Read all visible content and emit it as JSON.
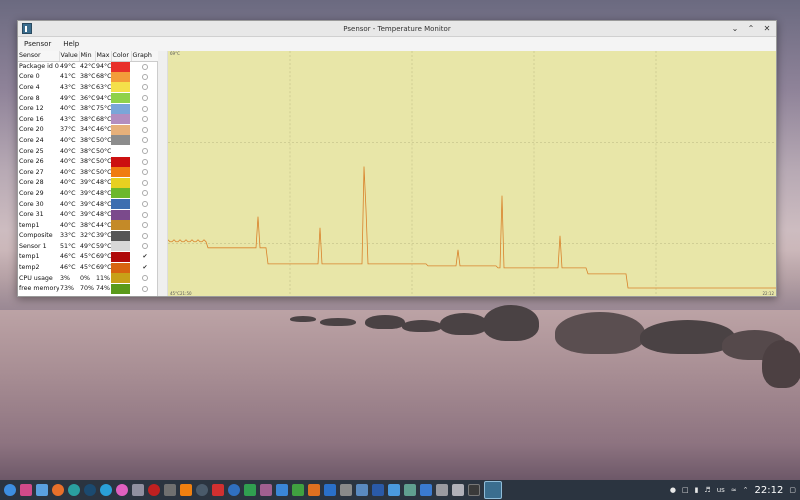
{
  "window": {
    "title": "Psensor - Temperature Monitor"
  },
  "menu": {
    "items": [
      "Psensor",
      "Help"
    ]
  },
  "table": {
    "headers": {
      "sensor": "Sensor",
      "value": "Value",
      "min": "Min",
      "max": "Max",
      "color": "Color",
      "graph": "Graph"
    },
    "rows": [
      {
        "sensor": "Package id 0",
        "value": "49°C",
        "min": "42°C",
        "max": "94°C",
        "color": "#e8302a",
        "graph": false
      },
      {
        "sensor": "Core 0",
        "value": "41°C",
        "min": "38°C",
        "max": "68°C",
        "color": "#f39c3a",
        "graph": false
      },
      {
        "sensor": "Core 4",
        "value": "43°C",
        "min": "38°C",
        "max": "63°C",
        "color": "#f4e04a",
        "graph": false
      },
      {
        "sensor": "Core 8",
        "value": "49°C",
        "min": "36°C",
        "max": "94°C",
        "color": "#8fd24a",
        "graph": false
      },
      {
        "sensor": "Core 12",
        "value": "40°C",
        "min": "38°C",
        "max": "75°C",
        "color": "#7aa6d8",
        "graph": false
      },
      {
        "sensor": "Core 16",
        "value": "43°C",
        "min": "38°C",
        "max": "68°C",
        "color": "#b38ec0",
        "graph": false
      },
      {
        "sensor": "Core 20",
        "value": "37°C",
        "min": "34°C",
        "max": "46°C",
        "color": "#e6b07a",
        "graph": false
      },
      {
        "sensor": "Core 24",
        "value": "40°C",
        "min": "38°C",
        "max": "50°C",
        "color": "#8c8c8c",
        "graph": false
      },
      {
        "sensor": "Core 25",
        "value": "40°C",
        "min": "38°C",
        "max": "50°C",
        "color": "#ffffff",
        "graph": false
      },
      {
        "sensor": "Core 26",
        "value": "40°C",
        "min": "38°C",
        "max": "50°C",
        "color": "#cc1010",
        "graph": false
      },
      {
        "sensor": "Core 27",
        "value": "40°C",
        "min": "38°C",
        "max": "50°C",
        "color": "#f07c10",
        "graph": false
      },
      {
        "sensor": "Core 28",
        "value": "40°C",
        "min": "39°C",
        "max": "48°C",
        "color": "#e8d020",
        "graph": false
      },
      {
        "sensor": "Core 29",
        "value": "40°C",
        "min": "39°C",
        "max": "48°C",
        "color": "#6cb82c",
        "graph": false
      },
      {
        "sensor": "Core 30",
        "value": "40°C",
        "min": "39°C",
        "max": "48°C",
        "color": "#3d6eb0",
        "graph": false
      },
      {
        "sensor": "Core 31",
        "value": "40°C",
        "min": "39°C",
        "max": "48°C",
        "color": "#7b4a8c",
        "graph": false
      },
      {
        "sensor": "temp1",
        "value": "40°C",
        "min": "38°C",
        "max": "44°C",
        "color": "#c48a28",
        "graph": false
      },
      {
        "sensor": "Composite",
        "value": "33°C",
        "min": "32°C",
        "max": "39°C",
        "color": "#555555",
        "graph": false
      },
      {
        "sensor": "Sensor 1",
        "value": "51°C",
        "min": "49°C",
        "max": "59°C",
        "color": "#d8d8d8",
        "graph": false
      },
      {
        "sensor": "temp1",
        "value": "46°C",
        "min": "45°C",
        "max": "69°C",
        "color": "#b00a0a",
        "graph": true
      },
      {
        "sensor": "temp2",
        "value": "46°C",
        "min": "45°C",
        "max": "69°C",
        "color": "#d86410",
        "graph": true
      },
      {
        "sensor": "CPU usage",
        "value": "3%",
        "min": "0%",
        "max": "11%",
        "color": "#c8a018",
        "graph": false
      },
      {
        "sensor": "free memory",
        "value": "73%",
        "min": "70%",
        "max": "74%",
        "color": "#5a9a1a",
        "graph": false
      }
    ]
  },
  "graph": {
    "bg_color": "#e8e6a8",
    "line_color": "#d9822b",
    "y_top_label": "69°C",
    "y_bottom_label": "45°C",
    "x_left_label": "21:50",
    "x_right_label": "22:12"
  },
  "taskbar": {
    "keyboard_layout": "us",
    "clock": "22:12"
  }
}
